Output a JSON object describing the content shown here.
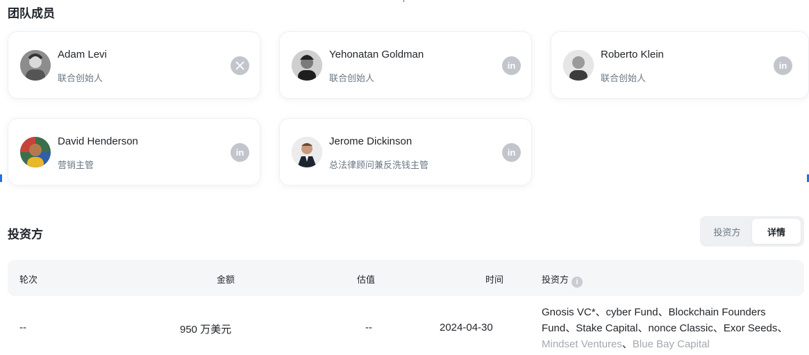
{
  "team": {
    "title": "团队成员",
    "members": [
      {
        "name": "Adam Levi",
        "role": "联合创始人",
        "social": "x-icon"
      },
      {
        "name": "Yehonatan Goldman",
        "role": "联合创始人",
        "social": "linkedin-icon"
      },
      {
        "name": "Roberto Klein",
        "role": "联合创始人",
        "social": "linkedin-icon"
      },
      {
        "name": "David Henderson",
        "role": "营销主管",
        "social": "linkedin-icon"
      },
      {
        "name": "Jerome Dickinson",
        "role": "总法律顾问兼反洗钱主管",
        "social": "linkedin-icon"
      }
    ]
  },
  "investors": {
    "title": "投资方",
    "toggle": {
      "investors_label": "投资方",
      "detail_label": "详情",
      "active": "详情"
    },
    "columns": {
      "round": "轮次",
      "amount": "金额",
      "valuation": "估值",
      "date": "时间",
      "investors": "投资方"
    },
    "rows": [
      {
        "round": "--",
        "amount": "950 万美元",
        "valuation": "--",
        "date": "2024-04-30",
        "investor_names": [
          {
            "text": "Gnosis VC*",
            "muted": false
          },
          {
            "text": "cyber Fund",
            "muted": false
          },
          {
            "text": "Blockchain Founders Fund",
            "muted": false
          },
          {
            "text": "Stake Capital",
            "muted": false
          },
          {
            "text": "nonce Classic",
            "muted": false
          },
          {
            "text": "Exor Seeds",
            "muted": false
          },
          {
            "text": "Mindset Ventures",
            "muted": true
          },
          {
            "text": "Blue Bay Capital",
            "muted": true
          }
        ],
        "separator": "、"
      }
    ]
  },
  "colors": {
    "muted_text": "#a3a9b1",
    "icon_gray": "#c2c6cc",
    "header_bg": "#f5f6f8"
  }
}
